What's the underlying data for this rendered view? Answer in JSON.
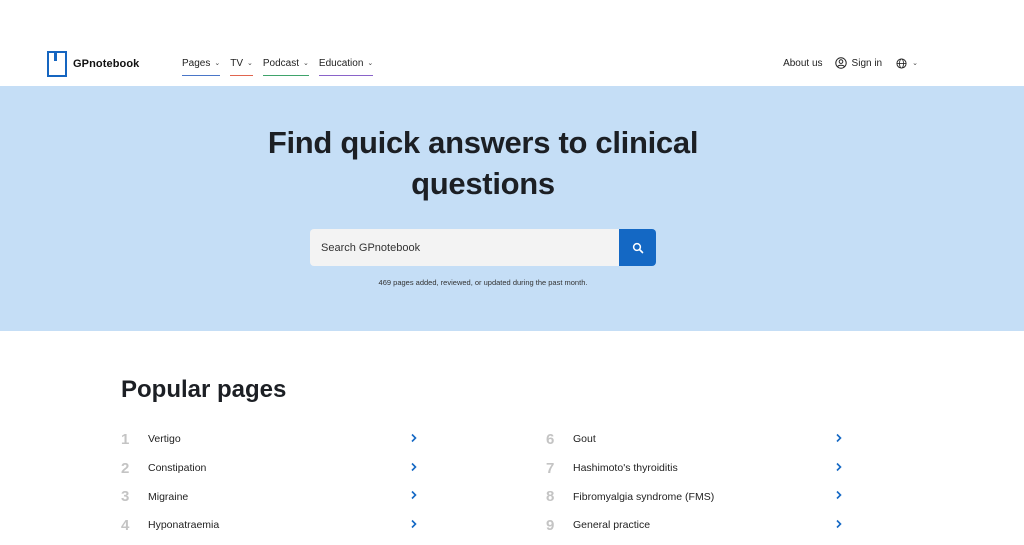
{
  "header": {
    "logo_text": "GPnotebook",
    "nav": [
      {
        "label": "Pages"
      },
      {
        "label": "TV"
      },
      {
        "label": "Podcast"
      },
      {
        "label": "Education"
      }
    ],
    "about_label": "About us",
    "signin_label": "Sign in"
  },
  "hero": {
    "title_line1": "Find quick answers to clinical",
    "title_line2": "questions",
    "search_placeholder": "Search GPnotebook",
    "note": "469 pages added, reviewed, or updated during the past month."
  },
  "popular": {
    "title": "Popular pages",
    "left": [
      {
        "num": "1",
        "label": "Vertigo"
      },
      {
        "num": "2",
        "label": "Constipation"
      },
      {
        "num": "3",
        "label": "Migraine"
      },
      {
        "num": "4",
        "label": "Hyponatraemia"
      }
    ],
    "right": [
      {
        "num": "6",
        "label": "Gout"
      },
      {
        "num": "7",
        "label": "Hashimoto's thyroiditis"
      },
      {
        "num": "8",
        "label": "Fibromyalgia syndrome (FMS)"
      },
      {
        "num": "9",
        "label": "General practice"
      }
    ]
  },
  "colors": {
    "brand_blue": "#1468c4",
    "hero_bg": "#c5def6"
  }
}
